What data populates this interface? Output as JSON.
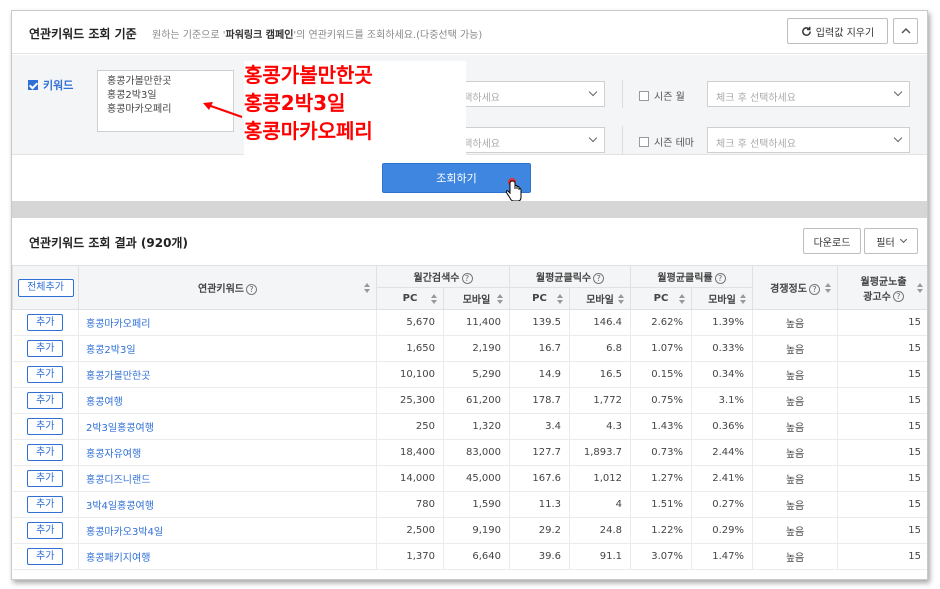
{
  "criteria": {
    "title": "연관키워드 조회 기준",
    "desc_prefix": "원하는 기준으로 '",
    "desc_highlight": "파워링크 캠페인",
    "desc_suffix": "'의 연관키워드를 조회하세요.(다중선택 가능)",
    "reset_label": "입력값 지우기",
    "keyword_label": "키워드",
    "keywords": [
      "홍콩가볼만한곳",
      "홍콩2박3일",
      "홍콩마카오페리"
    ],
    "select_placeholder_1": "선택하세요",
    "select_placeholder_2": "선택하세요",
    "season_month_label": "시즌 월",
    "season_theme_label": "시즌 테마",
    "season_placeholder": "체크 후 선택하세요",
    "search_label": "조회하기"
  },
  "annotation": {
    "lines": [
      "홍콩가볼만한곳",
      "홍콩2박3일",
      "홍콩마카오페리"
    ],
    "color": "#ff0000"
  },
  "results": {
    "title": "연관키워드 조회 결과 (920개)",
    "download_label": "다운로드",
    "filter_label": "필터",
    "add_all_label": "전체추가",
    "add_label": "추가",
    "headers": {
      "keyword": "연관키워드",
      "monthly_search": "월간검색수",
      "avg_clicks": "월평균클릭수",
      "avg_ctr": "월평균클릭률",
      "competition": "경쟁정도",
      "avg_ads_line1": "월평균노출",
      "avg_ads_line2": "광고수",
      "pc": "PC",
      "mobile": "모바일"
    },
    "rows": [
      {
        "kw": "홍콩마카오페리",
        "s_pc": "5,670",
        "s_mo": "11,400",
        "c_pc": "139.5",
        "c_mo": "146.4",
        "r_pc": "2.62%",
        "r_mo": "1.39%",
        "comp": "높음",
        "ads": "15"
      },
      {
        "kw": "홍콩2박3일",
        "s_pc": "1,650",
        "s_mo": "2,190",
        "c_pc": "16.7",
        "c_mo": "6.8",
        "r_pc": "1.07%",
        "r_mo": "0.33%",
        "comp": "높음",
        "ads": "15"
      },
      {
        "kw": "홍콩가볼만한곳",
        "s_pc": "10,100",
        "s_mo": "5,290",
        "c_pc": "14.9",
        "c_mo": "16.5",
        "r_pc": "0.15%",
        "r_mo": "0.34%",
        "comp": "높음",
        "ads": "15"
      },
      {
        "kw": "홍콩여행",
        "s_pc": "25,300",
        "s_mo": "61,200",
        "c_pc": "178.7",
        "c_mo": "1,772",
        "r_pc": "0.75%",
        "r_mo": "3.1%",
        "comp": "높음",
        "ads": "15"
      },
      {
        "kw": "2박3일홍콩여행",
        "s_pc": "250",
        "s_mo": "1,320",
        "c_pc": "3.4",
        "c_mo": "4.3",
        "r_pc": "1.43%",
        "r_mo": "0.36%",
        "comp": "높음",
        "ads": "15"
      },
      {
        "kw": "홍콩자유여행",
        "s_pc": "18,400",
        "s_mo": "83,000",
        "c_pc": "127.7",
        "c_mo": "1,893.7",
        "r_pc": "0.73%",
        "r_mo": "2.44%",
        "comp": "높음",
        "ads": "15"
      },
      {
        "kw": "홍콩디즈니랜드",
        "s_pc": "14,000",
        "s_mo": "45,000",
        "c_pc": "167.6",
        "c_mo": "1,012",
        "r_pc": "1.27%",
        "r_mo": "2.41%",
        "comp": "높음",
        "ads": "15"
      },
      {
        "kw": "3박4일홍콩여행",
        "s_pc": "780",
        "s_mo": "1,590",
        "c_pc": "11.3",
        "c_mo": "4",
        "r_pc": "1.51%",
        "r_mo": "0.27%",
        "comp": "높음",
        "ads": "15"
      },
      {
        "kw": "홍콩마카오3박4일",
        "s_pc": "2,500",
        "s_mo": "9,190",
        "c_pc": "29.2",
        "c_mo": "24.8",
        "r_pc": "1.22%",
        "r_mo": "0.29%",
        "comp": "높음",
        "ads": "15"
      },
      {
        "kw": "홍콩패키지여행",
        "s_pc": "1,370",
        "s_mo": "6,640",
        "c_pc": "39.6",
        "c_mo": "91.1",
        "r_pc": "3.07%",
        "r_mo": "1.47%",
        "comp": "높음",
        "ads": "15"
      }
    ]
  },
  "colors": {
    "accent": "#2f6fd6",
    "button_blue": "#3f86e0",
    "annotation_red": "#ff0000"
  }
}
